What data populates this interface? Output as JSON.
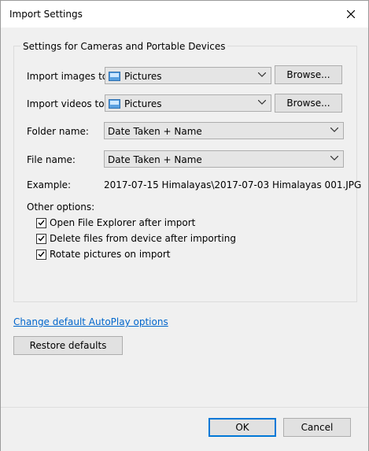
{
  "window": {
    "title": "Import Settings"
  },
  "group": {
    "legend": "Settings for Cameras and Portable Devices"
  },
  "import_images": {
    "label": "Import images to:",
    "value": "Pictures",
    "browse": "Browse..."
  },
  "import_videos": {
    "label": "Import videos to:",
    "value": "Pictures",
    "browse": "Browse..."
  },
  "folder_name": {
    "label": "Folder name:",
    "value": "Date Taken + Name"
  },
  "file_name": {
    "label": "File name:",
    "value": "Date Taken + Name"
  },
  "example": {
    "label": "Example:",
    "value": "2017-07-15 Himalayas\\2017-07-03 Himalayas 001.JPG"
  },
  "other_options": {
    "label": "Other options:",
    "items": [
      {
        "label": "Open File Explorer after import",
        "checked": true
      },
      {
        "label": "Delete files from device after importing",
        "checked": true
      },
      {
        "label": "Rotate pictures on import",
        "checked": true
      }
    ]
  },
  "autoplay_link": "Change default AutoPlay options",
  "restore_defaults": "Restore defaults",
  "ok": "OK",
  "cancel": "Cancel",
  "colors": {
    "accent": "#0078d7",
    "link": "#0066cc"
  },
  "icons": {
    "close": "close-icon",
    "pictures": "pictures-folder-icon",
    "chevron": "chevron-down-icon",
    "check": "checkmark-icon"
  }
}
